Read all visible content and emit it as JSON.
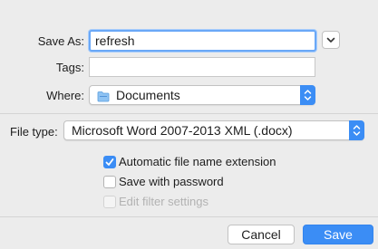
{
  "save_as": {
    "label": "Save As:",
    "value": "refresh"
  },
  "tags": {
    "label": "Tags:",
    "value": ""
  },
  "where": {
    "label": "Where:",
    "value": "Documents",
    "icon": "folder-icon"
  },
  "file_type": {
    "label": "File type:",
    "value": "Microsoft Word 2007-2013 XML (.docx)"
  },
  "options": [
    {
      "label": "Automatic file name extension",
      "checked": true,
      "disabled": false
    },
    {
      "label": "Save with password",
      "checked": false,
      "disabled": false
    },
    {
      "label": "Edit filter settings",
      "checked": false,
      "disabled": true
    }
  ],
  "buttons": {
    "cancel": "Cancel",
    "save": "Save"
  },
  "colors": {
    "accent": "#3b8df5",
    "background": "#ececec"
  }
}
